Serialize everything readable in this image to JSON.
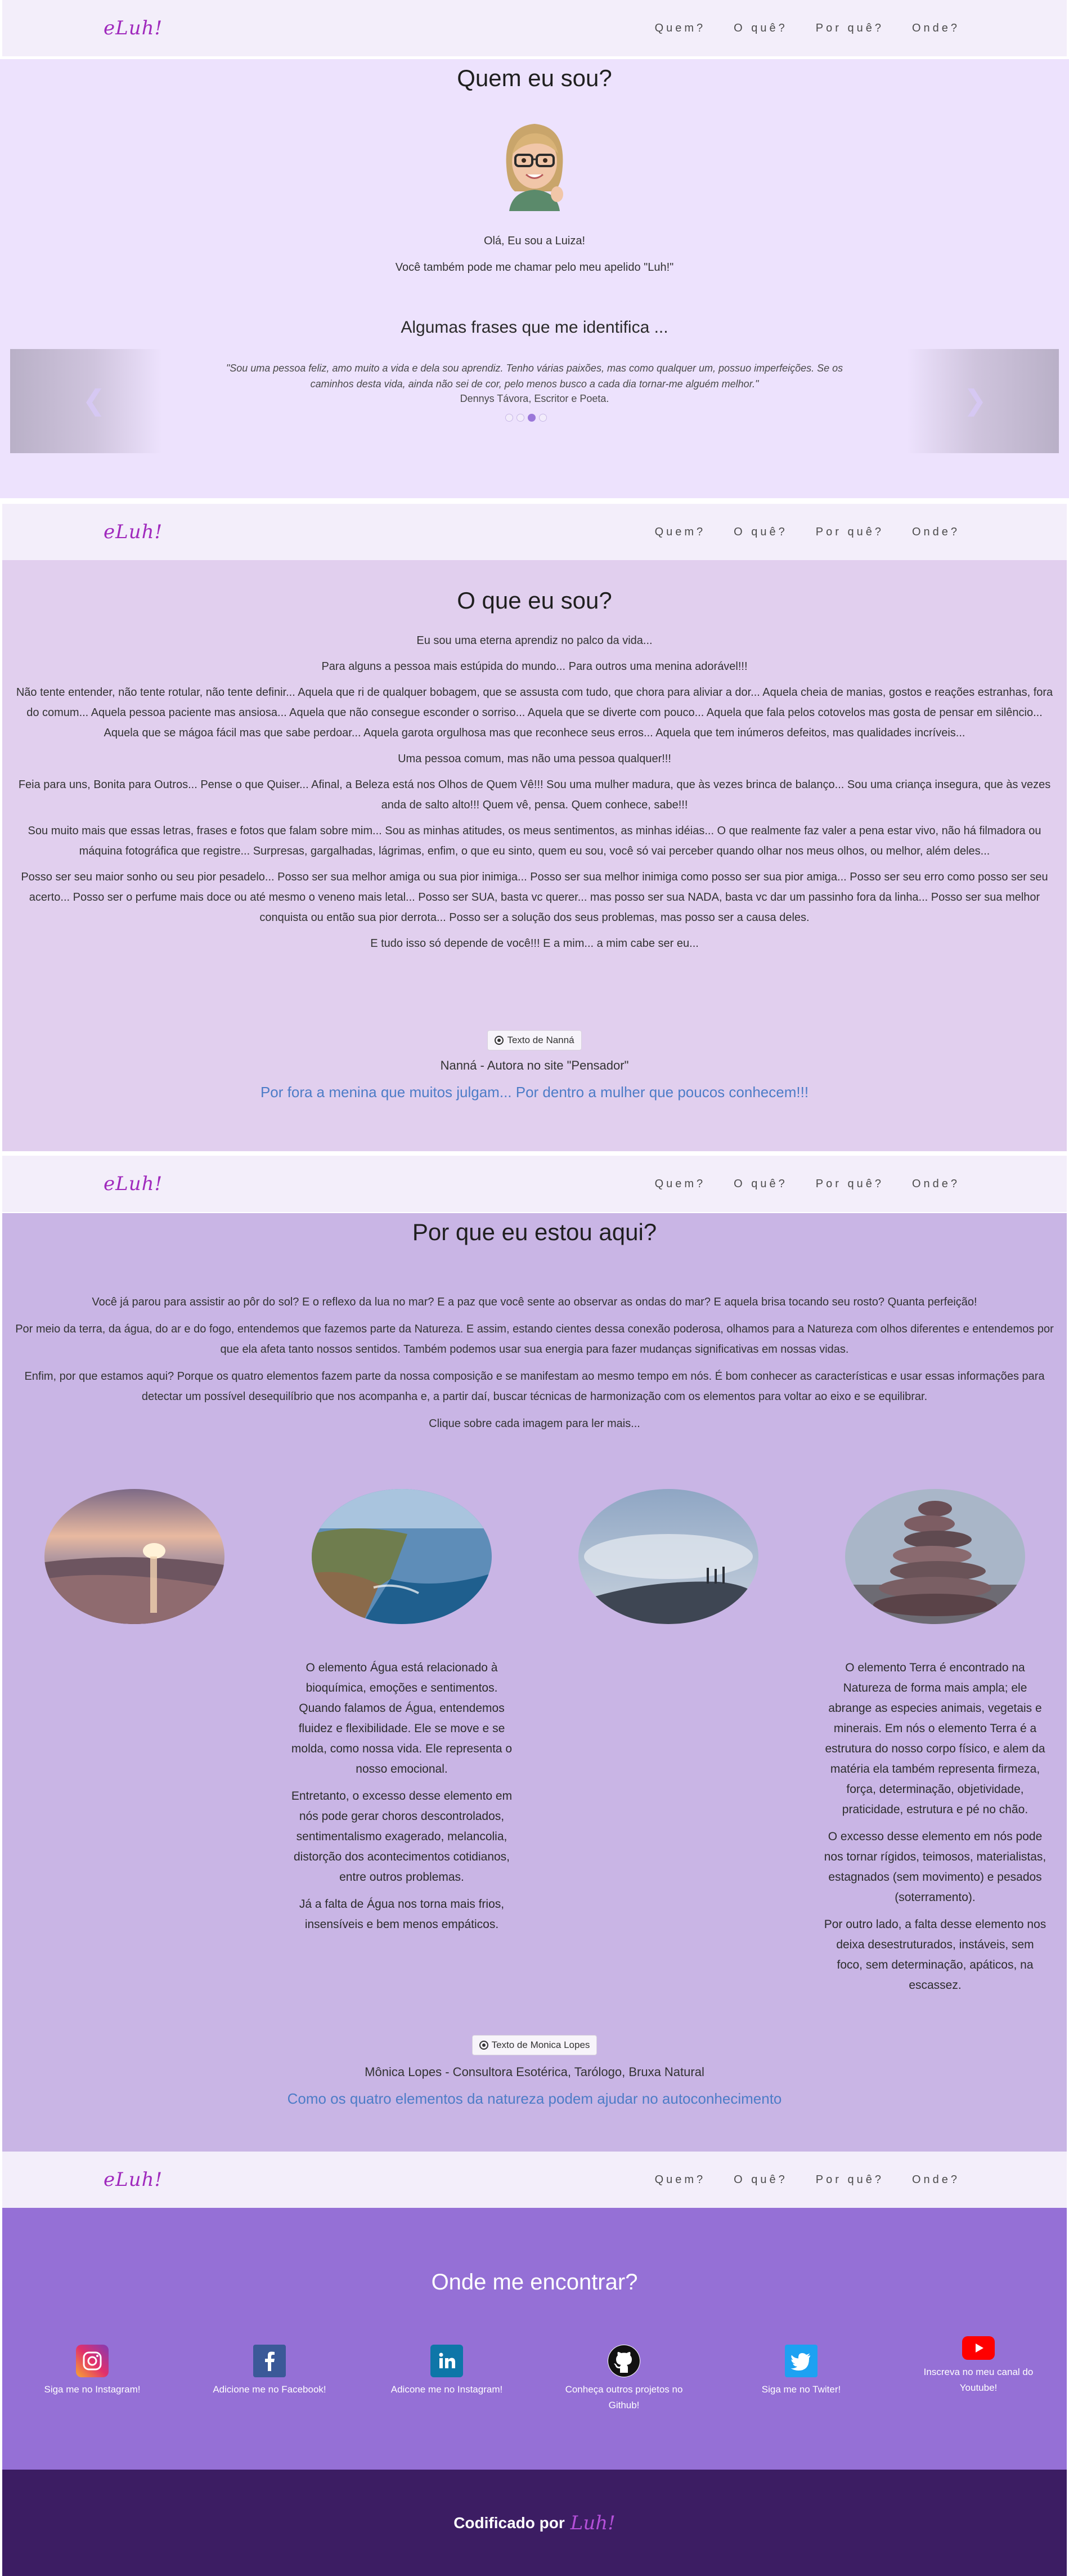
{
  "nav": {
    "logo": "eLuh!",
    "items": [
      "Quem?",
      "O quê?",
      "Por quê?",
      "Onde?"
    ]
  },
  "quem": {
    "title": "Quem eu sou?",
    "intro1": "Olá, Eu sou a Luiza!",
    "intro2": "Você também pode me chamar pelo meu apelido \"Luh!\"",
    "frases_title": "Algumas frases que me identifica ...",
    "quote": "\"Sou uma pessoa feliz, amo muito a vida e dela sou aprendiz. Tenho várias paixões, mas como qualquer um, possuo imperfeições. Se os caminhos desta vida, ainda não sei de cor, pelo menos busco a cada dia tornar-me alguém melhor.\"",
    "quote_author": "Dennys Távora, Escritor e Poeta.",
    "prev_icon": "chevron-left-icon",
    "next_icon": "chevron-right-icon"
  },
  "oque": {
    "title": "O que eu sou?",
    "paragraphs": [
      "Eu sou uma eterna aprendiz no palco da vida...",
      "Para alguns a pessoa mais estúpida do mundo... Para outros uma menina adorável!!!",
      "Não tente entender, não tente rotular, não tente definir... Aquela que ri de qualquer bobagem, que se assusta com tudo, que chora para aliviar a dor... Aquela cheia de manias, gostos e reações estranhas, fora do comum... Aquela pessoa paciente mas ansiosa... Aquela que não consegue esconder o sorriso... Aquela que se diverte com pouco... Aquela que fala pelos cotovelos mas gosta de pensar em silêncio... Aquela que se mágoa fácil mas que sabe perdoar... Aquela garota orgulhosa mas que reconhece seus erros... Aquela que tem inúmeros defeitos, mas qualidades incríveis...",
      "Uma pessoa comum, mas não uma pessoa qualquer!!!",
      "Feia para uns, Bonita para Outros... Pense o que Quiser... Afinal, a Beleza está nos Olhos de Quem Vê!!! Sou uma mulher madura, que às vezes brinca de balanço... Sou uma criança insegura, que às vezes anda de salto alto!!! Quem vê, pensa. Quem conhece, sabe!!!",
      "Sou muito mais que essas letras, frases e fotos que falam sobre mim... Sou as minhas atitudes, os meus sentimentos, as minhas idéias... O que realmente faz valer a pena estar vivo, não há filmadora ou máquina fotográfica que registre... Surpresas, gargalhadas, lágrimas, enfim, o que eu sinto, quem eu sou, você só vai perceber quando olhar nos meus olhos, ou melhor, além deles...",
      "Posso ser seu maior sonho ou seu pior pesadelo... Posso ser sua melhor amiga ou sua pior inimiga... Posso ser sua melhor inimiga como posso ser sua pior amiga... Posso ser seu erro como posso ser seu acerto... Posso ser o perfume mais doce ou até mesmo o veneno mais letal... Posso ser SUA, basta vc querer... mas posso ser sua NADA, basta vc dar um passinho fora da linha... Posso ser sua melhor conquista ou então sua pior derrota... Posso ser a solução dos seus problemas, mas posso ser a causa deles.",
      "E tudo isso só depende de você!!! E a mim... a mim cabe ser eu..."
    ],
    "credit_button": "Texto de Nanná",
    "credit_author": "Nanná - Autora no site \"Pensador\"",
    "link": "Por fora a menina que muitos julgam... Por dentro a mulher que poucos conhecem!!!"
  },
  "porque": {
    "title": "Por que eu estou aqui?",
    "paragraphs": [
      "Você já parou para assistir ao pôr do sol? E o reflexo da lua no mar? E a paz que você sente ao observar as ondas do mar? E aquela brisa tocando seu rosto? Quanta perfeição!",
      "Por meio da terra, da água, do ar e do fogo, entendemos que fazemos parte da Natureza. E assim, estando cientes dessa conexão poderosa, olhamos para a Natureza com olhos diferentes e entendemos por que ela afeta tanto nossos sentidos. Também podemos usar sua energia para fazer mudanças significativas em nossas vidas.",
      "Enfim, por que estamos aqui? Porque os quatro elementos fazem parte da nossa composição e se manifestam ao mesmo tempo em nós. É bom conhecer as características e usar essas informações para detectar um possível desequilíbrio que nos acompanha e, a partir daí, buscar técnicas de harmonização com os elementos para voltar ao eixo e se equilibrar.",
      "Clique sobre cada imagem para ler mais..."
    ],
    "agua_text": [
      "O elemento Água está relacionado à bioquímica, emoções e sentimentos. Quando falamos de Água, entendemos fluidez e flexibilidade. Ele se move e se molda, como nossa vida. Ele representa o nosso emocional.",
      "Entretanto, o excesso desse elemento em nós pode gerar choros descontrolados, sentimentalismo exagerado, melancolia, distorção dos acontecimentos cotidianos, entre outros problemas.",
      "Já a falta de Água nos torna mais frios, insensíveis e bem menos empáticos."
    ],
    "terra_text": [
      "O elemento Terra é encontrado na Natureza de forma mais ampla; ele abrange as especies animais, vegetais e minerais. Em nós o elemento Terra é a estrutura do nosso corpo físico, e alem da matéria ela também representa firmeza, força, determinação, objetividade, praticidade, estrutura e pé no chão.",
      "O excesso desse elemento em nós pode nos tornar rígidos, teimosos, materialistas, estagnados (sem movimento) e pesados (soterramento).",
      "Por outro lado, a falta desse elemento nos deixa desestruturados, instáveis, sem foco, sem determinação, apáticos, na escassez."
    ],
    "credit_button": "Texto de Monica Lopes",
    "credit_author": "Mônica Lopes - Consultora Esotérica, Tarólogo, Bruxa Natural",
    "link": "Como os quatro elementos da natureza podem ajudar no autoconhecimento"
  },
  "onde": {
    "title": "Onde me encontrar?",
    "socials": [
      {
        "icon": "instagram-icon",
        "label": "Siga me no Instagram!"
      },
      {
        "icon": "facebook-icon",
        "label": "Adicione me no Facebook!"
      },
      {
        "icon": "linkedin-icon",
        "label": "Adicone me no Instagram!"
      },
      {
        "icon": "github-icon",
        "label": "Conheça outros projetos no Github!"
      },
      {
        "icon": "twitter-icon",
        "label": "Siga me no Twiter!"
      },
      {
        "icon": "youtube-icon",
        "label": "Inscreva no meu canal do Youtube!"
      }
    ]
  },
  "footer": {
    "text": "Codificado por",
    "logo": "Luh!"
  },
  "colors": {
    "accent": "#a02abd",
    "link": "#4d7cc7",
    "sec1_bg": "#ede2fd",
    "sec2_bg": "#e1cfee",
    "sec3_bg": "#c9b5e5",
    "sec4_bg": "#9570d6",
    "footer_bg": "#3c1d63"
  }
}
